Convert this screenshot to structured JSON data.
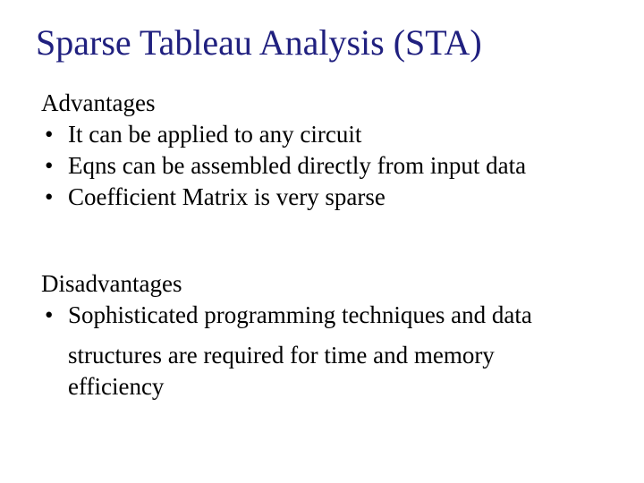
{
  "title": "Sparse Tableau Analysis (STA)",
  "section1": {
    "heading": "Advantages",
    "b1": "It can be applied to any circuit",
    "b2": "Eqns can be assembled directly from input data",
    "b3": "Coefficient Matrix is very sparse"
  },
  "section2": {
    "heading": "Disadvantages",
    "b1": "Sophisticated programming techniques and data",
    "b1_cont1": "structures are required for time and memory",
    "b1_cont2": "efficiency"
  }
}
